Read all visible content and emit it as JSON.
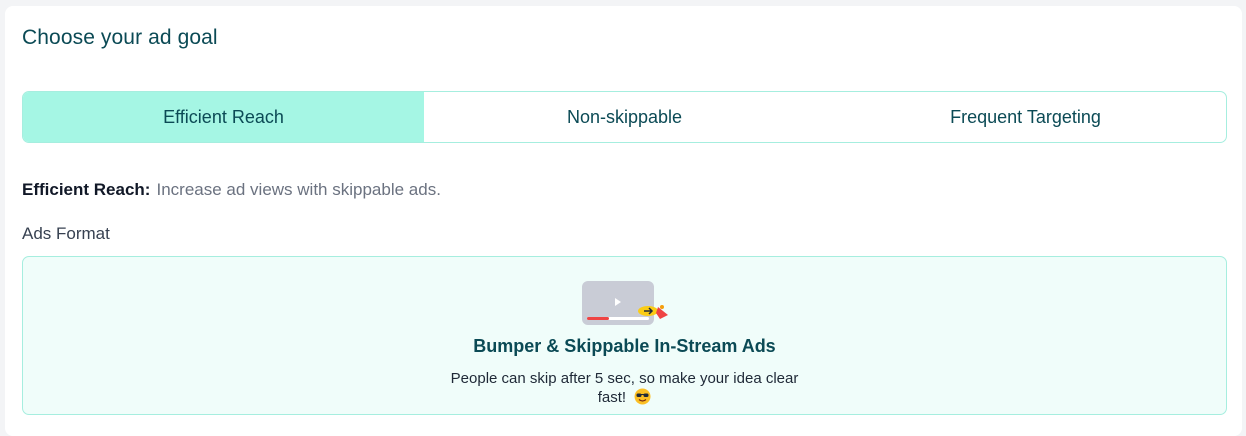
{
  "page": {
    "title": "Choose your ad goal"
  },
  "tabs": [
    {
      "label": "Efficient Reach",
      "active": true
    },
    {
      "label": "Non-skippable",
      "active": false
    },
    {
      "label": "Frequent Targeting",
      "active": false
    }
  ],
  "description": {
    "label": "Efficient Reach:",
    "text": "Increase ad views with skippable ads."
  },
  "ads_format": {
    "label": "Ads Format",
    "option": {
      "icon": "video-skip-icon",
      "title": "Bumper & Skippable In-Stream Ads",
      "description": "People can skip after 5 sec, so make your idea clear fast!",
      "emoji_icon": "cool-sunglasses-emoji-icon"
    }
  },
  "colors": {
    "accent": "#a5f6e4",
    "border": "#a6eedf",
    "heading": "#0b4a55",
    "card_bg": "#f0fdfa"
  }
}
